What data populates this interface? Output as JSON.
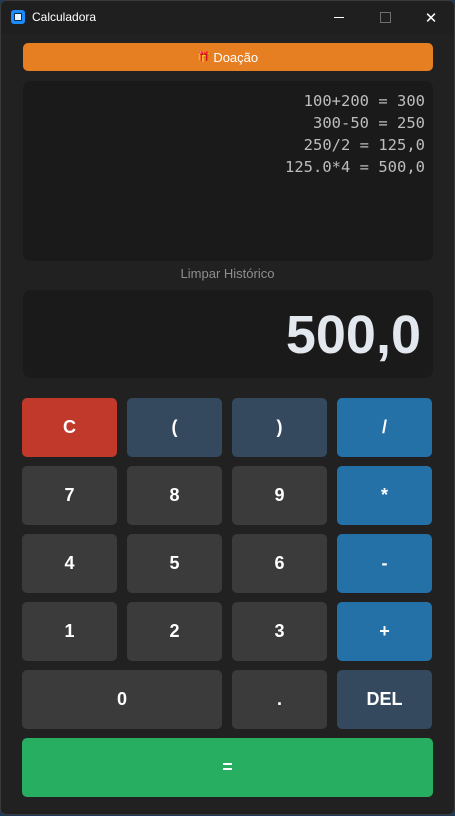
{
  "window": {
    "title": "Calculadora",
    "close_glyph": "✕"
  },
  "donate": {
    "icon": "gift-icon",
    "icon_glyph": "🎁",
    "label": "Doação"
  },
  "history": {
    "lines": [
      "100+200 = 300",
      "300-50 = 250",
      "250/2 = 125,0",
      "125.0*4 = 500,0"
    ]
  },
  "clear_history_label": "Limpar Histórico",
  "display": {
    "value": "500,0"
  },
  "keys": {
    "clear": "C",
    "open_paren": "(",
    "close_paren": ")",
    "divide": "/",
    "seven": "7",
    "eight": "8",
    "nine": "9",
    "multiply": "*",
    "four": "4",
    "five": "5",
    "six": "6",
    "minus": "-",
    "one": "1",
    "two": "2",
    "three": "3",
    "plus": "+",
    "zero": "0",
    "decimal": ".",
    "delete": "DEL",
    "equals": "="
  },
  "colors": {
    "donate": "#e67e22",
    "clear": "#c0392b",
    "paren": "#34495e",
    "operator": "#2471a8",
    "delete": "#34495e",
    "equals": "#27ae60",
    "digit": "#3b3b3b"
  }
}
